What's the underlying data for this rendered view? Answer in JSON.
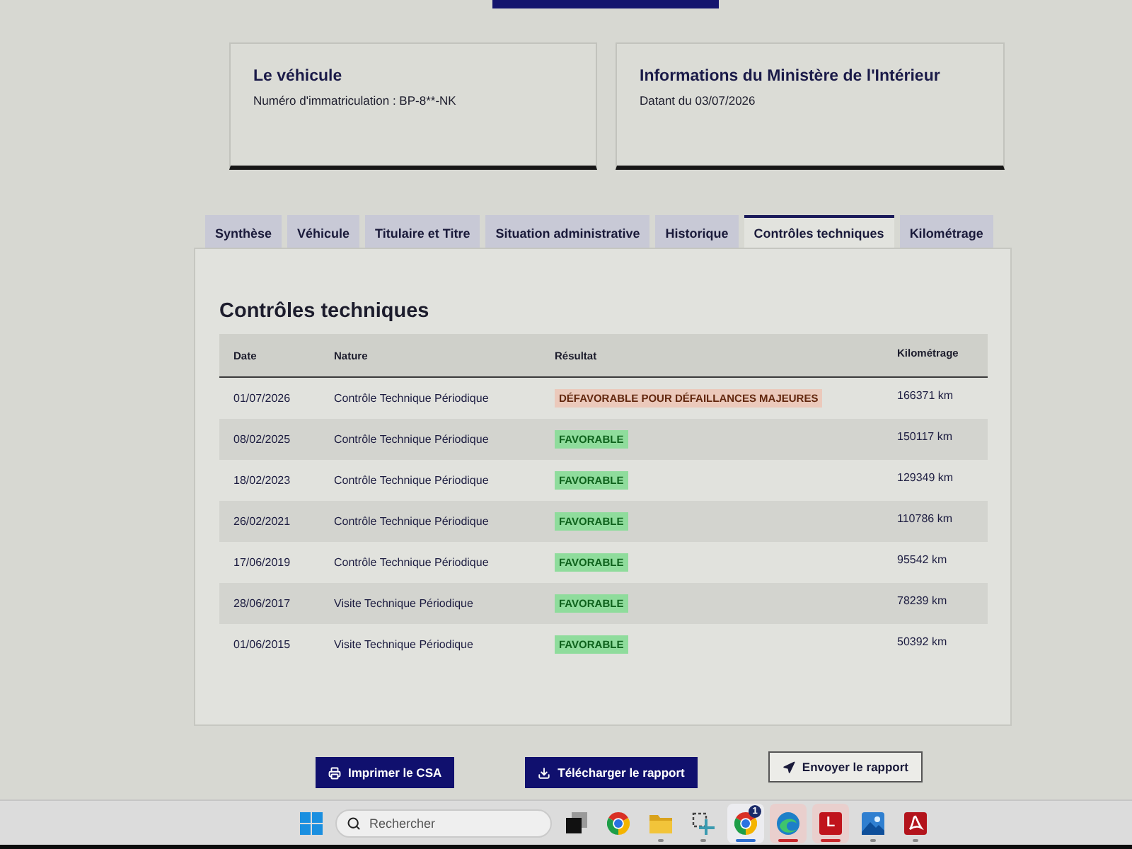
{
  "cards": [
    {
      "title": "Le véhicule",
      "text": "Numéro d'immatriculation : BP-8**-NK"
    },
    {
      "title": "Informations du Ministère de l'Intérieur",
      "text": "Datant du 03/07/2026"
    }
  ],
  "tabs": [
    {
      "label": "Synthèse",
      "selected": false
    },
    {
      "label": "Véhicule",
      "selected": false
    },
    {
      "label": "Titulaire et Titre",
      "selected": false
    },
    {
      "label": "Situation administrative",
      "selected": false
    },
    {
      "label": "Historique",
      "selected": false
    },
    {
      "label": "Contrôles techniques",
      "selected": true
    },
    {
      "label": "Kilométrage",
      "selected": false
    }
  ],
  "panel": {
    "title": "Contrôles techniques",
    "table": {
      "columns": [
        "Date",
        "Nature",
        "Résultat",
        "Kilométrage"
      ],
      "rows": [
        {
          "date": "01/07/2026",
          "nature": "Contrôle Technique Périodique",
          "result": "DÉFAVORABLE POUR DÉFAILLANCES MAJEURES",
          "color": "#ebc9bb",
          "km": "166371 km"
        },
        {
          "date": "08/02/2025",
          "nature": "Contrôle Technique Périodique",
          "result": "FAVORABLE",
          "color": "#8fdc9c",
          "km": "150117 km"
        },
        {
          "date": "18/02/2023",
          "nature": "Contrôle Technique Périodique",
          "result": "FAVORABLE",
          "color": "#8fdc9c",
          "km": "129349 km"
        },
        {
          "date": "26/02/2021",
          "nature": "Contrôle Technique Périodique",
          "result": "FAVORABLE",
          "color": "#8fdc9c",
          "km": "110786 km"
        },
        {
          "date": "17/06/2019",
          "nature": "Contrôle Technique Périodique",
          "result": "FAVORABLE",
          "color": "#8fdc9c",
          "km": "95542 km"
        },
        {
          "date": "28/06/2017",
          "nature": "Visite Technique Périodique",
          "result": "FAVORABLE",
          "color": "#8fdc9c",
          "km": "78239 km"
        },
        {
          "date": "01/06/2015",
          "nature": "Visite Technique Périodique",
          "result": "FAVORABLE",
          "color": "#8fdc9c",
          "km": "50392 km"
        }
      ]
    }
  },
  "actions": [
    {
      "label": "Imprimer le CSA",
      "kind": "print"
    },
    {
      "label": "Télécharger le rapport",
      "kind": "download"
    },
    {
      "label": "Envoyer le rapport",
      "kind": "send"
    }
  ],
  "taskbar": {
    "search": {
      "placeholder": "Rechercher"
    },
    "apps": [
      {
        "kind": "taskview",
        "open": false,
        "active": false
      },
      {
        "kind": "ring",
        "open": false,
        "active": false
      },
      {
        "kind": "folder",
        "open": true,
        "active": false
      },
      {
        "kind": "snip",
        "open": true,
        "active": false
      },
      {
        "kind": "ring",
        "open": true,
        "active": true,
        "color": "#2f6fd0",
        "badge": "1"
      },
      {
        "kind": "wave",
        "open": true,
        "active": true,
        "color": "#c8282c"
      },
      {
        "kind": "letter",
        "label": "L",
        "open": true,
        "active": true,
        "color": "#c8282c"
      },
      {
        "kind": "landscape",
        "open": true,
        "active": false
      },
      {
        "kind": "pdf",
        "open": true,
        "active": false
      }
    ]
  }
}
